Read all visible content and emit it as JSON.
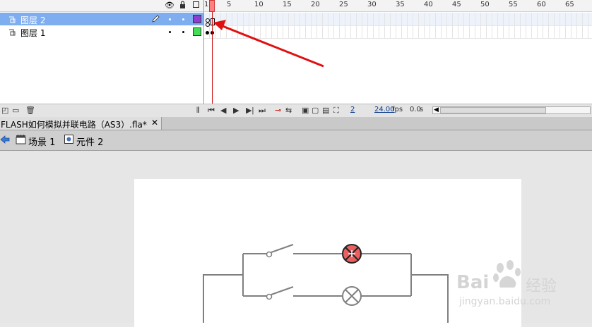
{
  "timeline": {
    "header_icons": [
      "eye-icon",
      "lock-icon",
      "outline-icon"
    ],
    "frame_labels": [
      "1",
      "5",
      "10",
      "15",
      "20",
      "25",
      "30",
      "35",
      "40",
      "45",
      "50",
      "55",
      "60",
      "65"
    ],
    "layers": [
      {
        "name": "图层 2",
        "selected": true,
        "color": "#8a3fd1",
        "icon": "layer-icon",
        "edit_icon": "pencil-icon"
      },
      {
        "name": "图层 1",
        "selected": false,
        "color": "#44dd55",
        "icon": "layer-icon"
      }
    ],
    "bottom": {
      "frame": "2",
      "fps": "24.00",
      "fps_unit": "fps",
      "time": "0.0",
      "time_unit": "s"
    }
  },
  "document_tab": {
    "title": "FLASH如何模拟并联电路（AS3）.fla*",
    "close": "✕"
  },
  "breadcrumbs": [
    {
      "label": "场景 1",
      "icon": "scene-icon"
    },
    {
      "label": "元件 2",
      "icon": "symbol-icon"
    }
  ],
  "watermark": {
    "logo": "Bai",
    "text": "经验",
    "url": "jingyan.baidu.com"
  },
  "colors": {
    "annotation_arrow": "#e01010",
    "lamp_active": "#e86060",
    "wire": "#808080"
  }
}
